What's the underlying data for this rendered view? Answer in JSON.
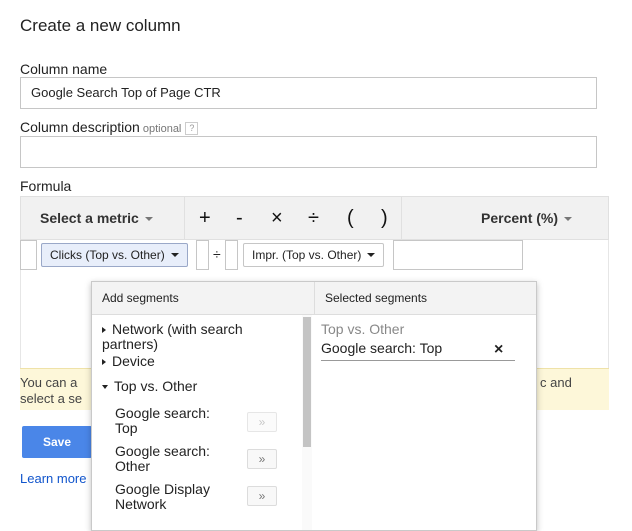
{
  "dialog": {
    "title": "Create a new column",
    "column_name_label": "Column name",
    "column_name_value": "Google Search Top of Page CTR",
    "column_description_label": "Column description",
    "column_description_optional": "optional",
    "column_description_value": "",
    "help_glyph": "?",
    "formula_label": "Formula"
  },
  "toolbar": {
    "select_metric": "Select a metric",
    "operators": [
      "+",
      "-",
      "×",
      "÷",
      "(",
      ")"
    ],
    "format": "Percent (%)"
  },
  "formula": {
    "metric_1": "Clicks (Top vs. Other)",
    "operator": "÷",
    "metric_2": "Impr. (Top vs. Other)"
  },
  "warning": {
    "line1_left": "You can a",
    "line2_left": "select a se",
    "line1_right": "c and"
  },
  "actions": {
    "save": "Save",
    "learn_more": "Learn more"
  },
  "segments_popup": {
    "add_header": "Add segments",
    "selected_header": "Selected segments",
    "items": [
      {
        "label": "Network (with search partners)",
        "state": "collapsed"
      },
      {
        "label": "Device",
        "state": "collapsed"
      },
      {
        "label": "Top vs. Other",
        "state": "expanded"
      }
    ],
    "subitems": [
      {
        "label": "Google search: Top",
        "button": "»",
        "enabled": false
      },
      {
        "label": "Google search: Other",
        "button": "»",
        "enabled": true
      },
      {
        "label": "Google Display Network",
        "button": "»",
        "enabled": true
      }
    ],
    "selected_group": "Top vs. Other",
    "selected_item": "Google search: Top",
    "remove_glyph": "×"
  }
}
